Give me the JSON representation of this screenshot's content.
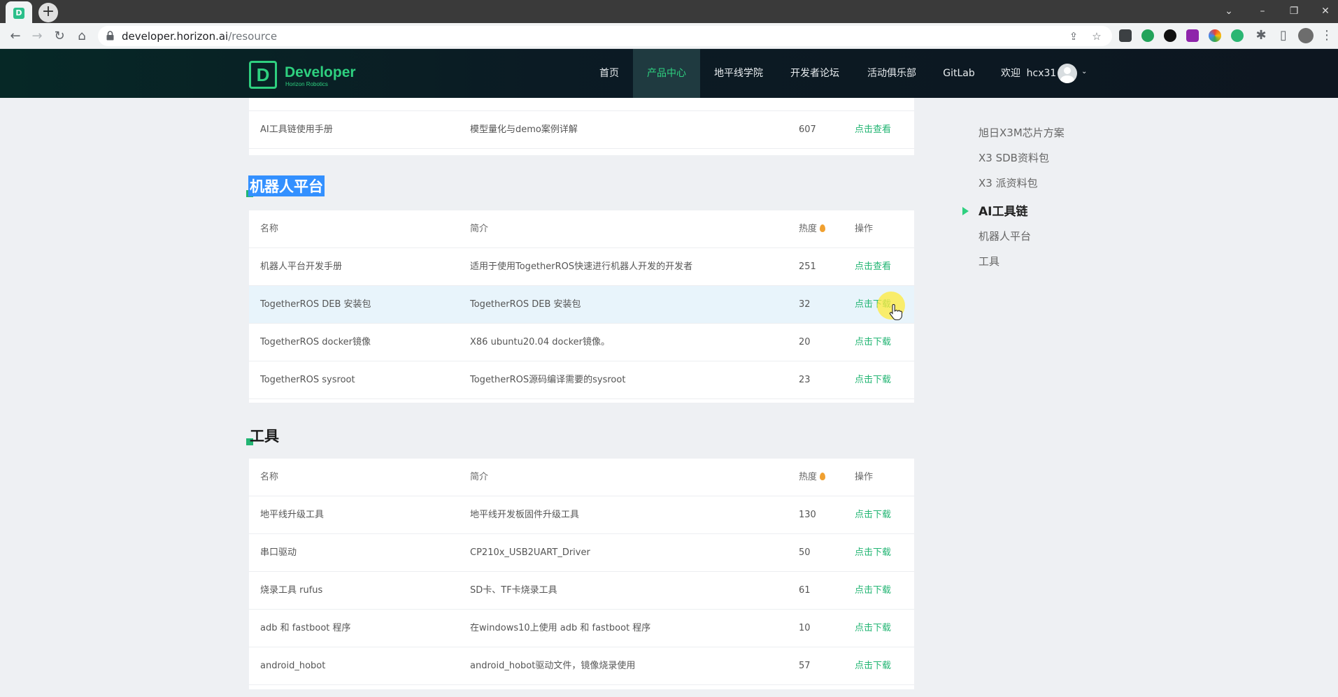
{
  "browser": {
    "tab_favicon": "D",
    "url_host": "developer.horizon.ai",
    "url_path": "/resource"
  },
  "site": {
    "logo_letter": "D",
    "logo_title": "Developer",
    "logo_subtitle": "Horizon Robotics",
    "nav": [
      {
        "label": "首页"
      },
      {
        "label": "产品中心",
        "active": true
      },
      {
        "label": "地平线学院"
      },
      {
        "label": "开发者论坛"
      },
      {
        "label": "活动俱乐部"
      },
      {
        "label": "GitLab"
      }
    ],
    "welcome": "欢迎",
    "username": "hcx31",
    "accent_color": "#2ed07f",
    "link_color": "#22b573"
  },
  "prev_section": {
    "row": {
      "name": "AI工具链使用手册",
      "desc": "模型量化与demo案例详解",
      "heat": "607",
      "action": "点击查看"
    }
  },
  "robot_section": {
    "title": "机器人平台",
    "headers": {
      "name": "名称",
      "desc": "简介",
      "heat": "热度",
      "action": "操作"
    },
    "rows": [
      {
        "name": "机器人平台开发手册",
        "desc": "适用于使用TogetherROS快速进行机器人开发的开发者",
        "heat": "251",
        "action": "点击查看"
      },
      {
        "name": "TogetherROS DEB 安装包",
        "desc": "TogetherROS DEB 安装包",
        "heat": "32",
        "action": "点击下载"
      },
      {
        "name": "TogetherROS docker镜像",
        "desc": "X86 ubuntu20.04 docker镜像。",
        "heat": "20",
        "action": "点击下载"
      },
      {
        "name": "TogetherROS sysroot",
        "desc": "TogetherROS源码编译需要的sysroot",
        "heat": "23",
        "action": "点击下载"
      }
    ]
  },
  "tools_section": {
    "title": "工具",
    "headers": {
      "name": "名称",
      "desc": "简介",
      "heat": "热度",
      "action": "操作"
    },
    "rows": [
      {
        "name": "地平线升级工具",
        "desc": "地平线开发板固件升级工具",
        "heat": "130",
        "action": "点击下载"
      },
      {
        "name": "串口驱动",
        "desc": "CP210x_USB2UART_Driver",
        "heat": "50",
        "action": "点击下载"
      },
      {
        "name": "烧录工具 rufus",
        "desc": "SD卡、TF卡烧录工具",
        "heat": "61",
        "action": "点击下载"
      },
      {
        "name": "adb 和 fastboot 程序",
        "desc": "在windows10上使用 adb 和 fastboot 程序",
        "heat": "10",
        "action": "点击下载"
      },
      {
        "name": "android_hobot",
        "desc": "android_hobot驱动文件，镜像烧录使用",
        "heat": "57",
        "action": "点击下载"
      }
    ]
  },
  "sidebar": {
    "items": [
      {
        "label": "旭日X3M芯片方案"
      },
      {
        "label": "X3 SDB资料包"
      },
      {
        "label": "X3 派资料包"
      },
      {
        "label": "AI工具链",
        "active": true
      },
      {
        "label": "机器人平台"
      },
      {
        "label": "工具"
      }
    ]
  }
}
